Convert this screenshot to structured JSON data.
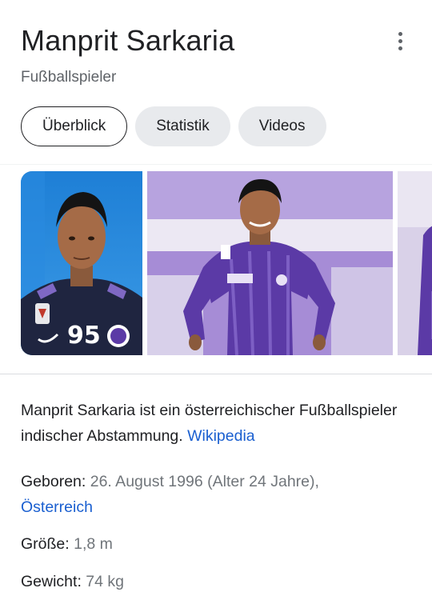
{
  "header": {
    "title": "Manprit Sarkaria",
    "subtitle": "Fußballspieler"
  },
  "tabs": [
    {
      "label": "Überblick",
      "active": true
    },
    {
      "label": "Statistik",
      "active": false
    },
    {
      "label": "Videos",
      "active": false
    }
  ],
  "gallery": {
    "photos": [
      "portrait-photo",
      "action-photo",
      "partial-photo"
    ],
    "jersey_number": "95"
  },
  "description": {
    "text": "Manprit Sarkaria ist ein österreichischer Fußballspieler indischer Abstammung. ",
    "source_link": "Wikipedia"
  },
  "facts": {
    "born_label": "Geboren: ",
    "born_value": "26. August 1996 (Alter 24 Jahre), ",
    "born_place": "Österreich",
    "height_label": "Größe: ",
    "height_value": "1,8 m",
    "weight_label": "Gewicht: ",
    "weight_value": "74 kg"
  },
  "colors": {
    "link": "#1a5fd0",
    "tab_bg": "#e8eaed",
    "jersey_purple": "#5b3aa6"
  }
}
